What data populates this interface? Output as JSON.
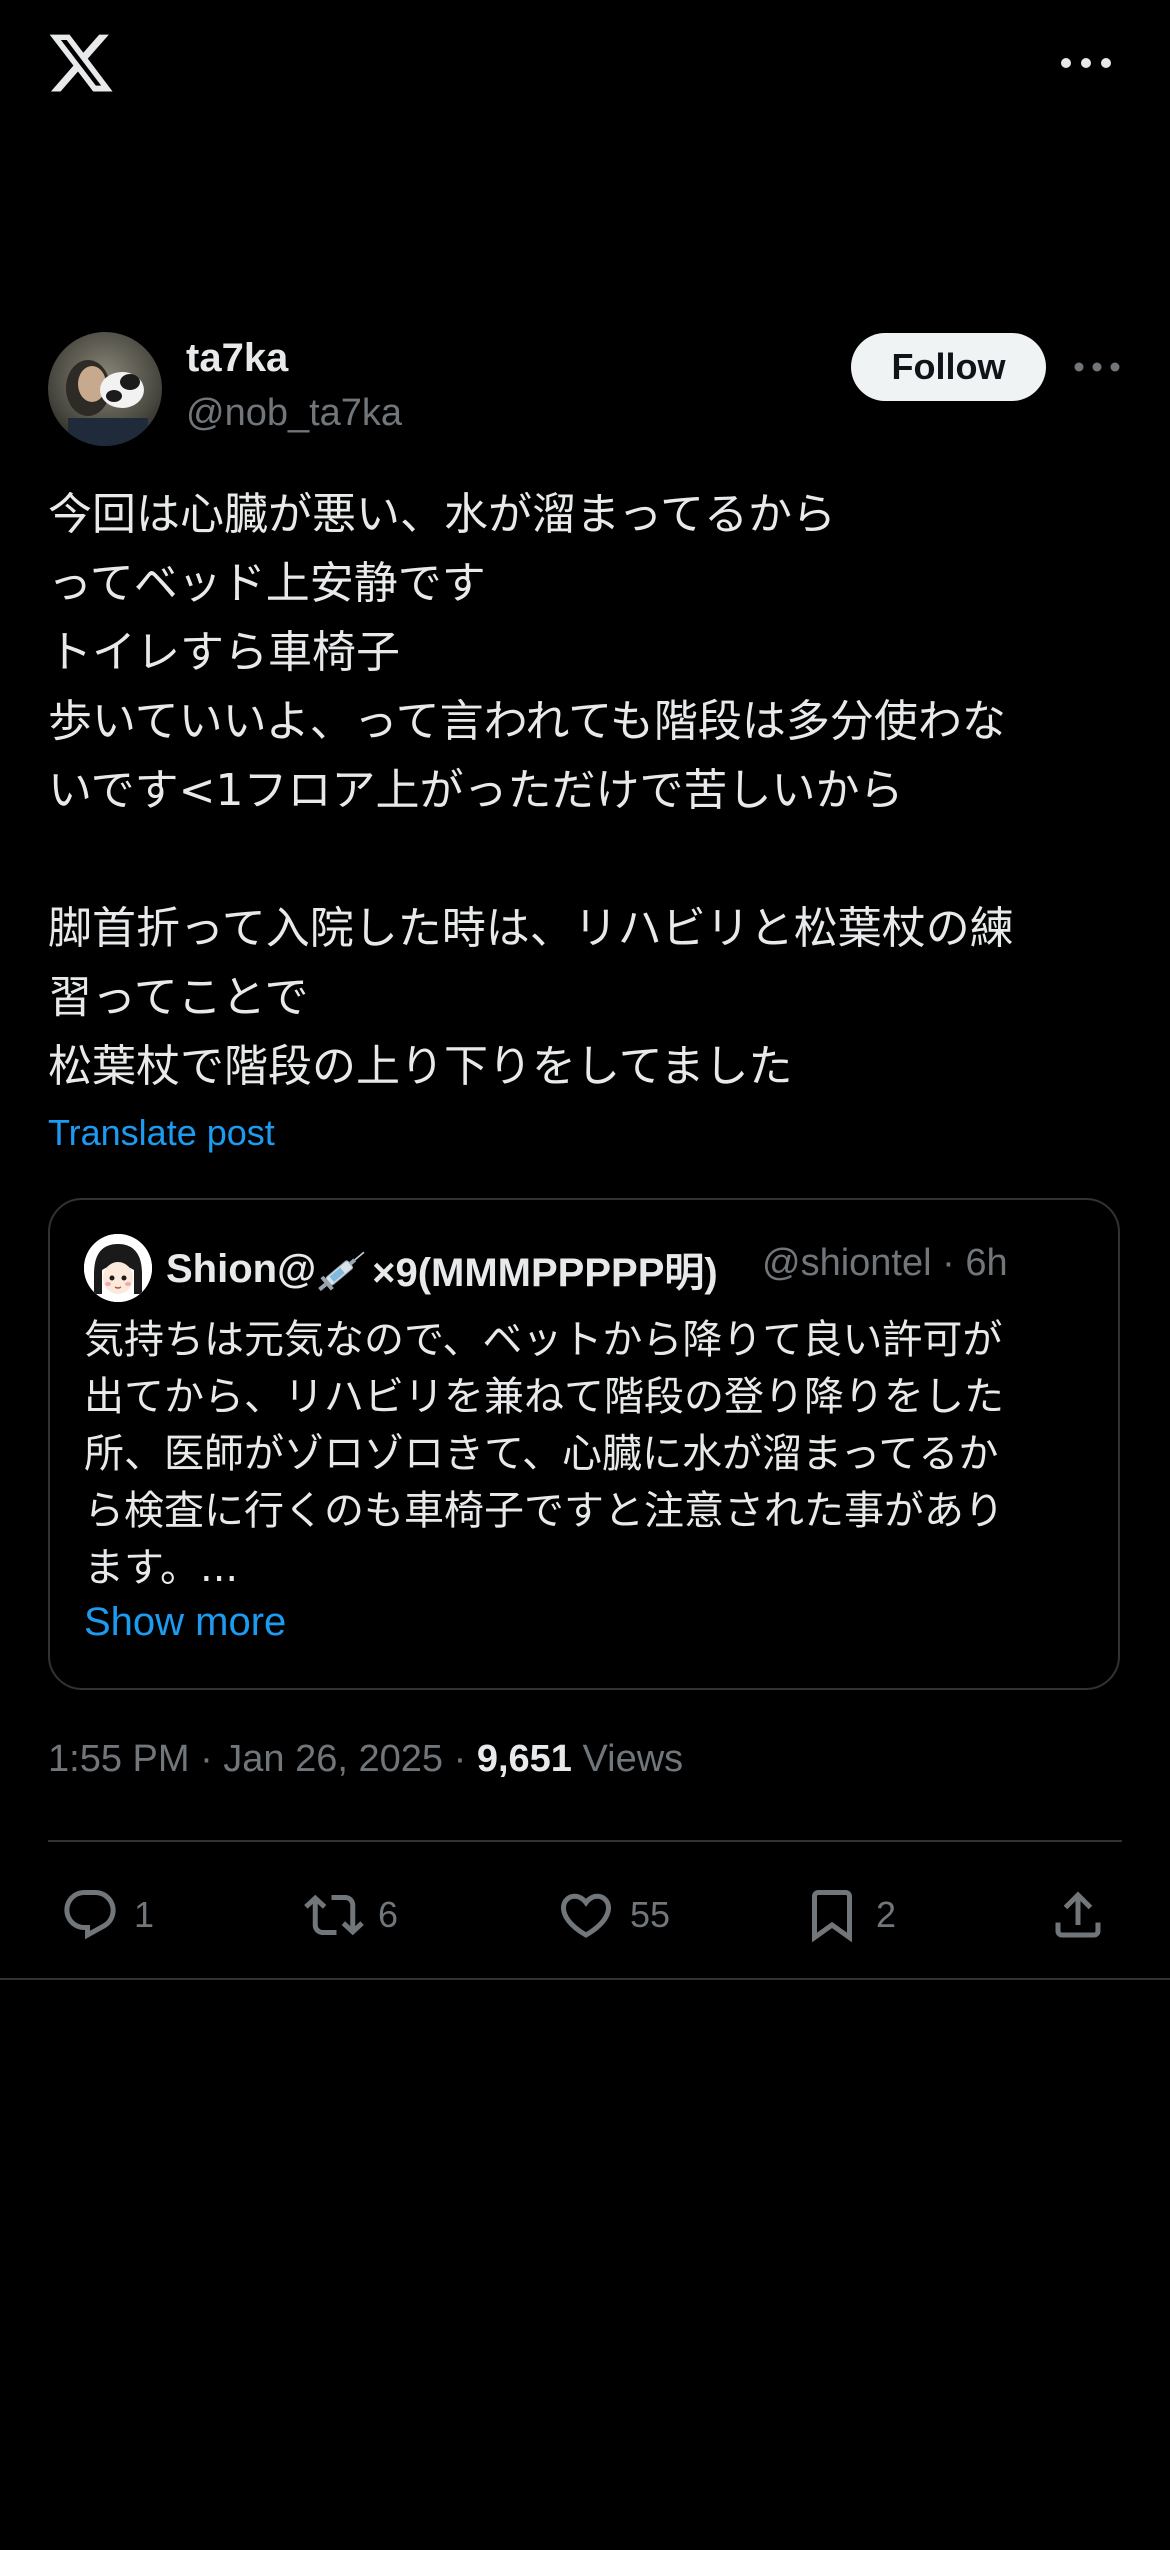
{
  "topbar": {
    "logo_icon": "x-logo-icon",
    "more_icon": "more-horizontal-icon"
  },
  "post": {
    "author": {
      "display_name": "ta7ka",
      "handle": "@nob_ta7ka"
    },
    "follow_label": "Follow",
    "text_lines": [
      "今回は心臓が悪い、水が溜まってるから",
      "ってベッド上安静です",
      "トイレすら車椅子",
      "歩いていいよ、って言われても階段は多分使わな",
      "いです<1フロア上がっただけで苦しいから",
      "",
      "脚首折って入院した時は、リハビリと松葉杖の練",
      "習ってことで",
      "松葉杖で階段の上り下りをしてました"
    ],
    "translate_label": "Translate post",
    "quote": {
      "name_prefix": "Shion@",
      "name_suffix": "×9(MMMPPPPP明)",
      "handle": "@shiontel",
      "separator": "·",
      "time": "6h",
      "text_lines": [
        "気持ちは元気なので、ベットから降りて良い許可が",
        "出てから、リハビリを兼ねて階段の登り降りをした",
        "所、医師がゾロゾロきて、心臓に水が溜まってるか",
        "ら検査に行くのも車椅子ですと注意された事があり",
        "ます。..."
      ],
      "show_more_label": "Show more"
    },
    "timestamp": "1:55 PM · Jan 26, 2025 · ",
    "views_count": "9,651",
    "views_label": " Views",
    "actions": {
      "replies": "1",
      "reposts": "6",
      "likes": "55",
      "bookmarks": "2"
    }
  },
  "colors": {
    "background": "#000000",
    "text_primary": "#e7e9ea",
    "text_secondary": "#71767b",
    "link": "#1d9bf0",
    "border": "#2f3336",
    "follow_button_bg": "#eff3f4"
  }
}
